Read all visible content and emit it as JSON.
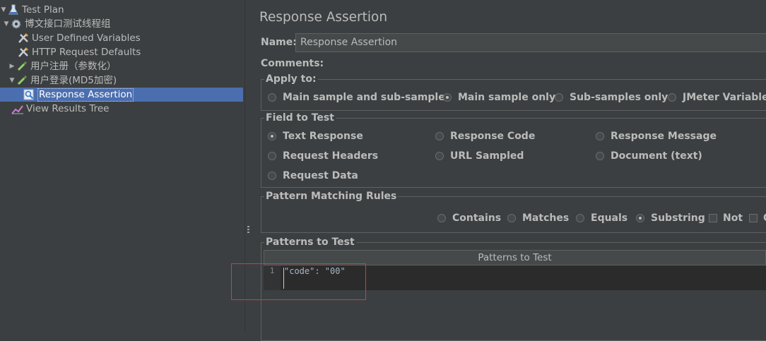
{
  "tree": {
    "nodes": [
      {
        "label": "Test Plan",
        "icon": "flask-icon"
      },
      {
        "label": "博文接口测试线程组",
        "icon": "gear-icon"
      },
      {
        "label": "User Defined Variables",
        "icon": "wrench-icon"
      },
      {
        "label": "HTTP Request Defaults",
        "icon": "wrench-icon"
      },
      {
        "label": "用户注册（参数化）",
        "icon": "pipette-icon"
      },
      {
        "label": "用户登录(MD5加密)",
        "icon": "pipette-icon"
      },
      {
        "label": "Response Assertion",
        "icon": "magnifier-icon"
      },
      {
        "label": "View Results Tree",
        "icon": "chart-icon"
      }
    ],
    "selected": "Response Assertion"
  },
  "panel": {
    "title": "Response Assertion",
    "name_label": "Name:",
    "name_value": "Response Assertion",
    "comments_label": "Comments:",
    "apply_to": {
      "title": "Apply to:",
      "options": [
        "Main sample and sub-samples",
        "Main sample only",
        "Sub-samples only",
        "JMeter Variable N"
      ],
      "selected": "Main sample only"
    },
    "field_to_test": {
      "title": "Field to Test",
      "options": [
        "Text Response",
        "Response Code",
        "Response Message",
        "Request Headers",
        "URL Sampled",
        "Document (text)",
        "Request Data"
      ],
      "selected": "Text Response"
    },
    "pattern_matching": {
      "title": "Pattern Matching Rules",
      "options": [
        "Contains",
        "Matches",
        "Equals",
        "Substring"
      ],
      "selected": "Substring",
      "checkboxes": [
        "Not",
        "O"
      ]
    },
    "patterns": {
      "title": "Patterns to Test",
      "column_header": "Patterns to Test",
      "line_number": "1",
      "code": "\"code\": \"00\""
    },
    "colors": {
      "highlight": "#4b6eaf",
      "annotation": "#d43c3c"
    }
  }
}
